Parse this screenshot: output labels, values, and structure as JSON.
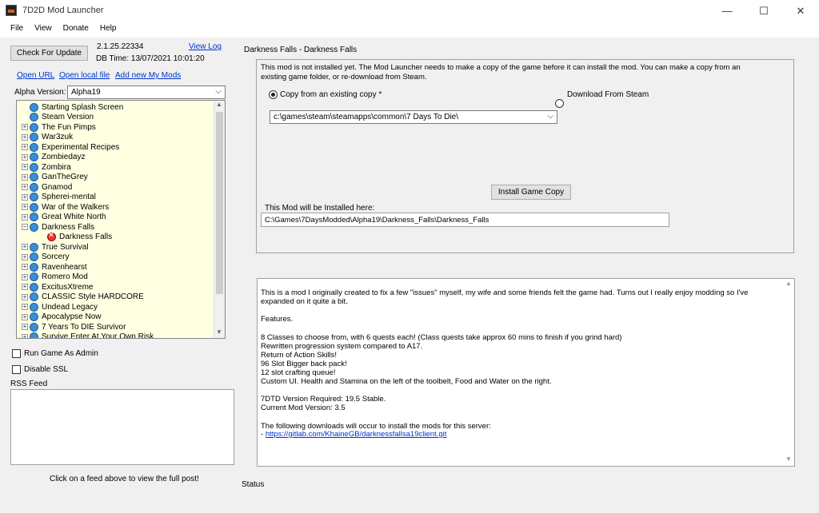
{
  "window": {
    "title": "7D2D Mod Launcher",
    "minimize": "—",
    "maximize": "☐",
    "close": "✕"
  },
  "menu": [
    "File",
    "View",
    "Donate",
    "Help"
  ],
  "top_left": {
    "check_update": "Check For Update",
    "version": "2.1.25.22334",
    "view_log": "View Log",
    "db_time": "DB Time: 13/07/2021 10:01:20",
    "open_url": "Open URL",
    "open_local": "Open local file",
    "add_mods": "Add new My Mods",
    "alpha_label": "Alpha Version:",
    "alpha_value": "Alpha19"
  },
  "tree": [
    {
      "label": "Starting Splash Screen",
      "expander": "",
      "indent": 0,
      "icon": "globe"
    },
    {
      "label": "Steam Version",
      "expander": "",
      "indent": 0,
      "icon": "globe"
    },
    {
      "label": "The Fun Pimps",
      "expander": "+",
      "indent": 0,
      "icon": "globe"
    },
    {
      "label": "War3zuk",
      "expander": "+",
      "indent": 0,
      "icon": "globe"
    },
    {
      "label": "Experimental Recipes",
      "expander": "+",
      "indent": 0,
      "icon": "globe"
    },
    {
      "label": "Zombiedayz",
      "expander": "+",
      "indent": 0,
      "icon": "globe"
    },
    {
      "label": "Zombira",
      "expander": "+",
      "indent": 0,
      "icon": "globe"
    },
    {
      "label": "GanTheGrey",
      "expander": "+",
      "indent": 0,
      "icon": "globe"
    },
    {
      "label": "Gnamod",
      "expander": "+",
      "indent": 0,
      "icon": "globe"
    },
    {
      "label": "Spherei-mental",
      "expander": "+",
      "indent": 0,
      "icon": "globe"
    },
    {
      "label": "War of the Walkers",
      "expander": "+",
      "indent": 0,
      "icon": "globe"
    },
    {
      "label": "Great White North",
      "expander": "+",
      "indent": 0,
      "icon": "globe"
    },
    {
      "label": "Darkness Falls",
      "expander": "−",
      "indent": 0,
      "icon": "globe"
    },
    {
      "label": "Darkness Falls",
      "expander": "",
      "indent": 1,
      "icon": "error"
    },
    {
      "label": "True Survival",
      "expander": "+",
      "indent": 0,
      "icon": "globe"
    },
    {
      "label": "Sorcery",
      "expander": "+",
      "indent": 0,
      "icon": "globe"
    },
    {
      "label": "Ravenhearst",
      "expander": "+",
      "indent": 0,
      "icon": "globe"
    },
    {
      "label": "Romero Mod",
      "expander": "+",
      "indent": 0,
      "icon": "globe"
    },
    {
      "label": "ExcitusXtreme",
      "expander": "+",
      "indent": 0,
      "icon": "globe"
    },
    {
      "label": "CLASSIC Style HARDCORE",
      "expander": "+",
      "indent": 0,
      "icon": "globe"
    },
    {
      "label": "Undead Legacy",
      "expander": "+",
      "indent": 0,
      "icon": "globe"
    },
    {
      "label": "Apocalypse Now",
      "expander": "+",
      "indent": 0,
      "icon": "globe"
    },
    {
      "label": "7 Years To DIE Survivor",
      "expander": "+",
      "indent": 0,
      "icon": "globe"
    },
    {
      "label": "Survive Enter At Your Own Risk",
      "expander": "+",
      "indent": 0,
      "icon": "globe"
    }
  ],
  "options": {
    "run_admin": "Run Game As Admin",
    "disable_ssl": "Disable SSL",
    "rss_label": "RSS Feed",
    "rss_hint": "Click on a feed above to view the full post!"
  },
  "mod": {
    "header": "Darkness Falls - Darkness Falls",
    "not_installed_1": "This mod is not installed yet. The Mod Launcher needs to make a copy of the game before it can install the mod. You can make a copy from an",
    "not_installed_2": "existing game folder, or re-download from Steam.",
    "copy_option": "Copy from an existing copy *",
    "download_option": "Download From Steam",
    "source_path": "c:\\games\\steam\\steamapps\\common\\7 Days To Die\\",
    "install_copy": "Install Game Copy",
    "install_here_label": "This Mod will be Installed here:",
    "install_path": "C:\\Games\\7DaysModded\\Alpha19\\Darkness_Falls\\Darkness_Falls"
  },
  "description": [
    "This is a mod I originally created to fix a few \"issues\" myself, my wife and some friends felt the game had. Turns out I really enjoy modding so I've",
    "expanded on it quite a bit.",
    "",
    "Features.",
    "",
    "8 Classes to choose from, with 6 quests each! (Class quests take approx 60 mins to finish if you grind hard)",
    "Rewritten progression system compared to A17.",
    "Return of Action Skills!",
    "96 Slot Bigger back pack!",
    "12 slot crafting queue!",
    "Custom UI. Health and Stamina on the left of the toolbelt, Food and Water on the right.",
    "",
    "7DTD Version Required: 19.5 Stable.",
    "Current Mod Version: 3.5",
    "",
    "The following downloads will occur to install the mods for this server:"
  ],
  "download_prefix": " - ",
  "download_link": "https://gitlab.com/KhaineGB/darknessfallsa19client.git",
  "status": "Status"
}
